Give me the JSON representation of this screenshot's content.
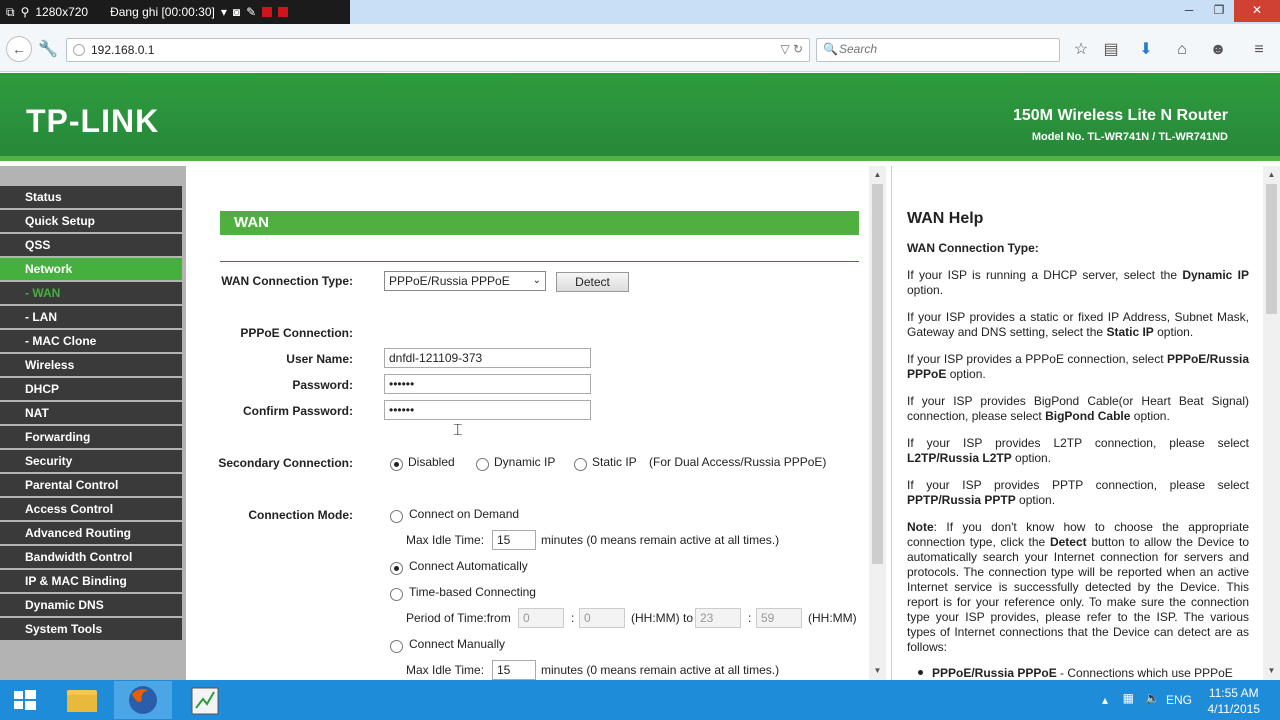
{
  "recorder": {
    "resolution": "1280x720",
    "status": "Đang ghi [00:00:30]"
  },
  "browser": {
    "url": "192.168.0.1",
    "search_placeholder": "Search"
  },
  "router": {
    "logo": "TP-LINK",
    "product": "150M Wireless Lite N Router",
    "model": "Model No. TL-WR741N / TL-WR741ND"
  },
  "sidebar": {
    "items": [
      {
        "label": "Status"
      },
      {
        "label": "Quick Setup"
      },
      {
        "label": "QSS"
      },
      {
        "label": "Network"
      },
      {
        "label": "- WAN"
      },
      {
        "label": "- LAN"
      },
      {
        "label": "- MAC Clone"
      },
      {
        "label": "Wireless"
      },
      {
        "label": "DHCP"
      },
      {
        "label": "NAT"
      },
      {
        "label": "Forwarding"
      },
      {
        "label": "Security"
      },
      {
        "label": "Parental Control"
      },
      {
        "label": "Access Control"
      },
      {
        "label": "Advanced Routing"
      },
      {
        "label": "Bandwidth Control"
      },
      {
        "label": "IP & MAC Binding"
      },
      {
        "label": "Dynamic DNS"
      },
      {
        "label": "System Tools"
      }
    ]
  },
  "wan": {
    "section_title": "WAN",
    "conn_type_label": "WAN Connection Type:",
    "conn_type_value": "PPPoE/Russia PPPoE",
    "detect_label": "Detect",
    "pppoe_label": "PPPoE Connection:",
    "username_label": "User Name:",
    "username_value": "dnfdl-121109-373",
    "password_label": "Password:",
    "password_value": "••••••",
    "confirm_label": "Confirm Password:",
    "confirm_value": "••••••",
    "secondary_label": "Secondary Connection:",
    "secondary_disabled": "Disabled",
    "secondary_dynamic": "Dynamic IP",
    "secondary_static": "Static IP",
    "secondary_note": "(For Dual Access/Russia PPPoE)",
    "mode_label": "Connection Mode:",
    "mode_on_demand": "Connect on Demand",
    "max_idle_label": "Max Idle Time:",
    "max_idle_value": "15",
    "max_idle_note": "minutes (0 means remain active at all times.)",
    "mode_auto": "Connect Automatically",
    "mode_time": "Time-based Connecting",
    "period_label": "Period of Time:from",
    "period_from_h": "0",
    "period_from_m": "0",
    "period_hhmm_to": "(HH:MM) to",
    "period_to_h": "23",
    "period_to_m": "59",
    "period_hhmm": "(HH:MM)",
    "colon": ":",
    "mode_manual": "Connect Manually",
    "max_idle_value2": "15"
  },
  "help": {
    "title": "WAN Help",
    "subtitle": "WAN Connection Type:",
    "p1a": "If your ISP is running a DHCP server, select the ",
    "p1b": "Dynamic IP",
    "p1c": " option.",
    "p2a": "If your ISP provides a static or fixed IP Address, Subnet Mask, Gateway and DNS setting, select the ",
    "p2b": "Static IP",
    "p2c": " option.",
    "p3a": "If your ISP provides a PPPoE connection, select ",
    "p3b": "PPPoE/Russia PPPoE",
    "p3c": " option.",
    "p4a": "If your ISP provides BigPond Cable(or Heart Beat Signal) connection, please select ",
    "p4b": "BigPond Cable",
    "p4c": " option.",
    "p5a": "If your ISP provides L2TP connection, please select ",
    "p5b": "L2TP/Russia L2TP",
    "p5c": " option.",
    "p6a": "If your ISP provides PPTP connection, please select ",
    "p6b": "PPTP/Russia PPTP",
    "p6c": " option.",
    "note_b": "Note",
    "note_a": ": If you don't know how to choose the appropriate connection type, click the ",
    "note_detect": "Detect",
    "note_c": " button to allow the Device to automatically search your Internet connection for servers and protocols. The connection type will be reported when an active Internet service is successfully detected by the Device. This report is for your reference only. To make sure the connection type your ISP provides, please refer to the ISP. The various types of Internet connections that the Device can detect are as follows:",
    "bullet_b": "PPPoE/Russia PPPoE",
    "bullet_a": " - Connections which use PPPoE"
  },
  "taskbar": {
    "lang": "ENG",
    "time": "11:55 AM",
    "date": "4/11/2015"
  },
  "colors": {
    "tp_green": "#2e9c3d",
    "menu_dark": "#3a3a3a",
    "menu_active": "#45b03d",
    "taskbar": "#1f8cd9"
  }
}
